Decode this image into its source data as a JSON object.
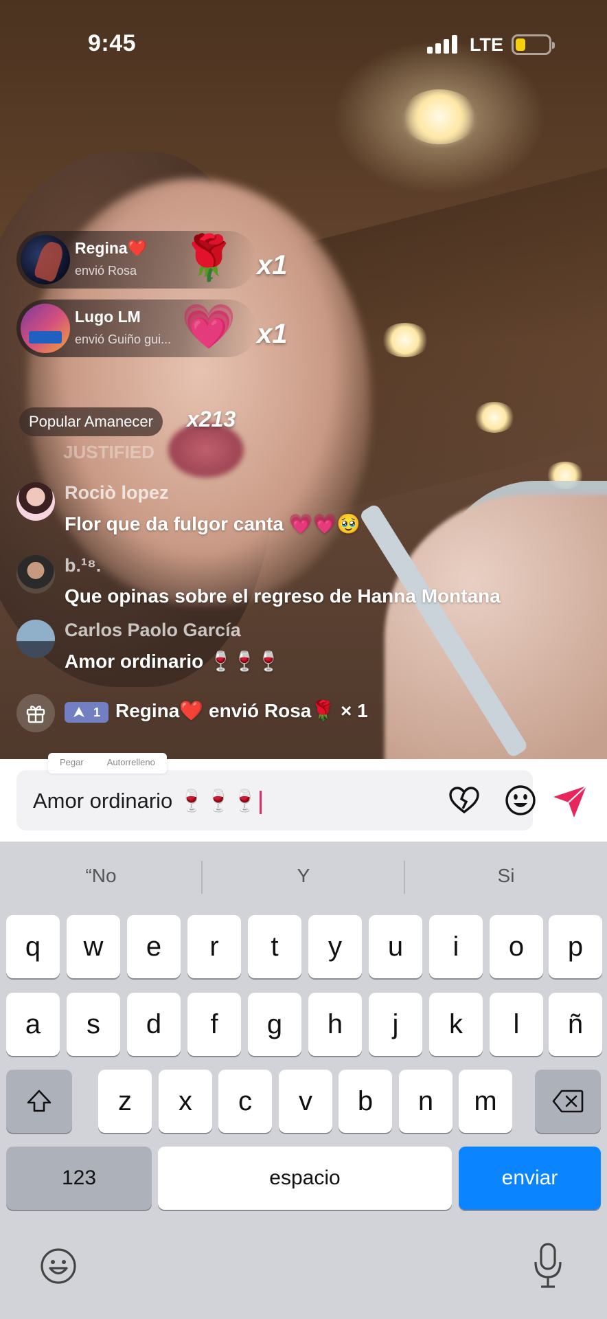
{
  "status_bar": {
    "time": "9:45",
    "network": "LTE"
  },
  "gift_notifications": [
    {
      "user": "Regina",
      "user_emoji": "❤️",
      "action": "envió Rosa",
      "gift_emoji": "🌹",
      "combo": "x1"
    },
    {
      "user": "Lugo LM",
      "user_emoji": "",
      "action": "envió Guiño gui...",
      "gift_emoji": "💗",
      "combo": "x1"
    }
  ],
  "popular": {
    "label": "Popular Amanecer",
    "count": "x213"
  },
  "faded_line": "JUSTIFIED",
  "chat": [
    {
      "user": "Rociò lopez",
      "message": "Flor que da fulgor canta 💗💗🥹"
    },
    {
      "user": "b.¹⁸.",
      "message": "Que opinas sobre el regreso de Hanna Montana"
    },
    {
      "user": "Carlos Paolo García",
      "message": "Amor ordinario 🍷🍷🍷"
    }
  ],
  "gift_line": {
    "rank": "1",
    "text": "Regina❤️ envió Rosa🌹 × 1"
  },
  "edit_menu": {
    "paste": "Pegar",
    "autofill": "Autorrelleno"
  },
  "input": {
    "value": "Amor ordinario 🍷🍷🍷"
  },
  "keyboard": {
    "suggestions": [
      "“No",
      "Y",
      "Si"
    ],
    "row1": [
      "q",
      "w",
      "e",
      "r",
      "t",
      "y",
      "u",
      "i",
      "o",
      "p"
    ],
    "row2": [
      "a",
      "s",
      "d",
      "f",
      "g",
      "h",
      "j",
      "k",
      "l",
      "ñ"
    ],
    "row3": [
      "z",
      "x",
      "c",
      "v",
      "b",
      "n",
      "m"
    ],
    "numbers_key": "123",
    "space_key": "espacio",
    "send_key": "enviar"
  },
  "colors": {
    "send_accent": "#e8265d",
    "keyboard_blue": "#0a84ff",
    "battery": "#f4d10a"
  }
}
